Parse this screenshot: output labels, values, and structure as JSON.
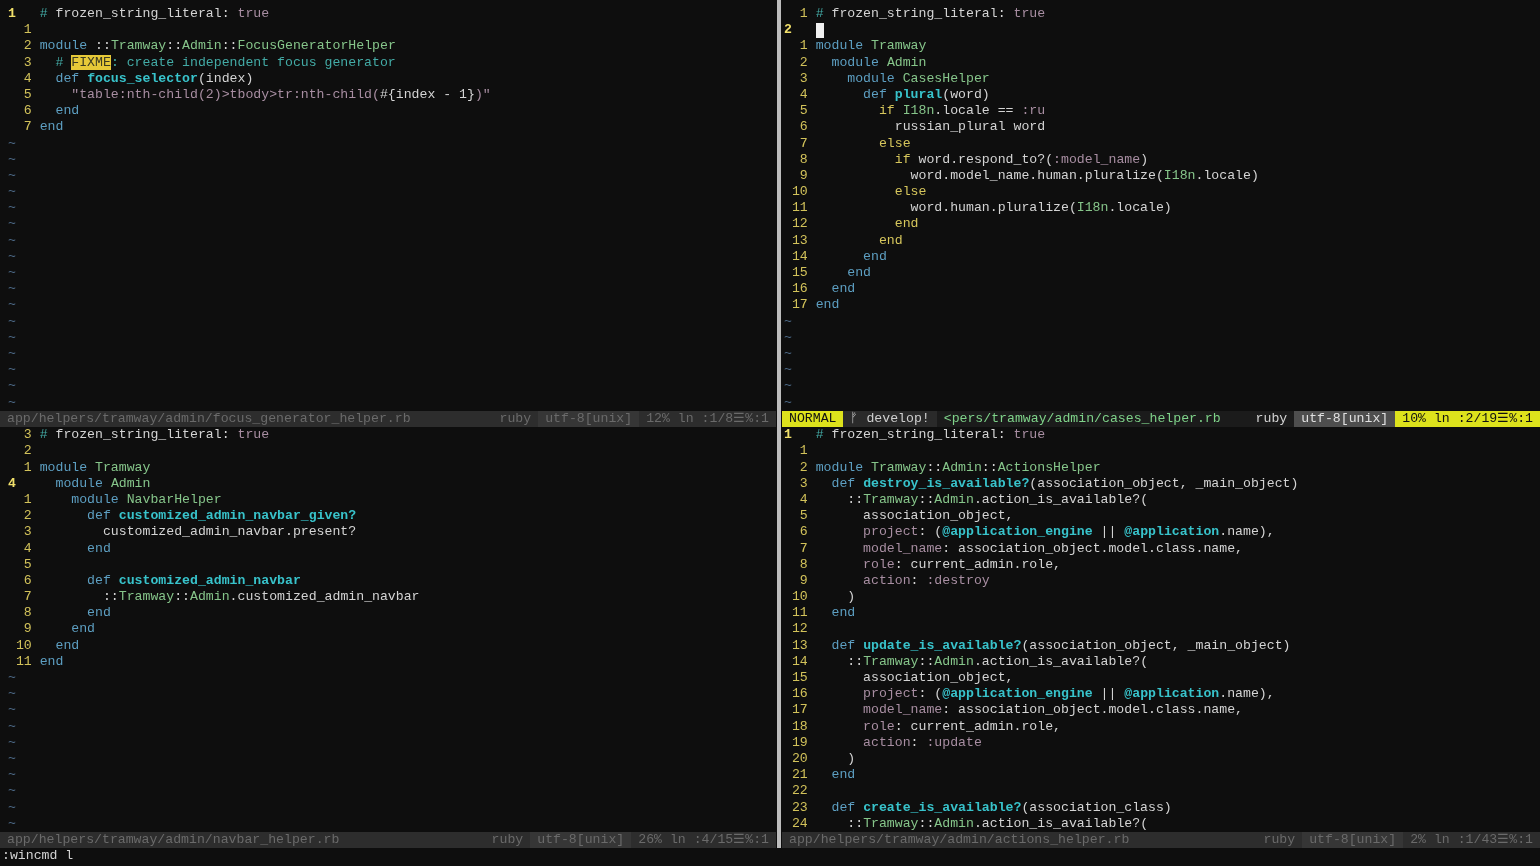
{
  "panes": [
    {
      "active": false,
      "lines": [
        {
          "num": "1",
          "current": true,
          "tokens": [
            {
              "kind": "comment",
              "text": "# "
            },
            {
              "kind": "note",
              "text": "frozen_string_literal: "
            },
            {
              "kind": "symbol",
              "text": "true"
            }
          ]
        },
        {
          "num": "1",
          "current": false
        },
        {
          "num": "2",
          "current": false,
          "tokens": [
            {
              "kind": "keyword",
              "text": "module "
            },
            {
              "kind": "plain",
              "text": "::"
            },
            {
              "kind": "constant",
              "text": "Tramway"
            },
            {
              "kind": "plain",
              "text": "::"
            },
            {
              "kind": "constant",
              "text": "Admin"
            },
            {
              "kind": "plain",
              "text": "::"
            },
            {
              "kind": "constant",
              "text": "FocusGeneratorHelper"
            }
          ]
        },
        {
          "num": "3",
          "current": false,
          "tokens": [
            {
              "kind": "comment",
              "text": "  # "
            },
            {
              "kind": "todo",
              "text": "FIXME"
            },
            {
              "kind": "comment",
              "text": ": create independent focus generator"
            }
          ]
        },
        {
          "num": "4",
          "current": false,
          "tokens": [
            {
              "kind": "keyword",
              "text": "  def "
            },
            {
              "kind": "method",
              "text": "focus_selector"
            },
            {
              "kind": "plain",
              "text": "(index)"
            }
          ]
        },
        {
          "num": "5",
          "current": false,
          "tokens": [
            {
              "kind": "string",
              "text": "    \"table:nth-child(2)>tbody>tr:nth-child("
            },
            {
              "kind": "plain",
              "text": "#{index - 1}"
            },
            {
              "kind": "string",
              "text": ")\""
            }
          ]
        },
        {
          "num": "6",
          "current": false,
          "tokens": [
            {
              "kind": "keyword",
              "text": "  end"
            }
          ]
        },
        {
          "num": "7",
          "current": false,
          "tokens": [
            {
              "kind": "keyword",
              "text": "end"
            }
          ]
        }
      ],
      "filler": [
        "~",
        "~",
        "~",
        "~",
        "~",
        "~",
        "~",
        "~",
        "~",
        "~",
        "~",
        "~",
        "~",
        "~",
        "~",
        "~",
        "~"
      ],
      "status": {
        "file": "app/helpers/tramway/admin/focus_generator_helper.rb",
        "filetype": "ruby",
        "encoding": "utf-8[unix]",
        "position": "12% ln :1/8☰%:1"
      }
    },
    {
      "active": true,
      "lines": [
        {
          "num": "1",
          "current": false,
          "tokens": [
            {
              "kind": "comment",
              "text": "# "
            },
            {
              "kind": "note",
              "text": "frozen_string_literal: "
            },
            {
              "kind": "symbol",
              "text": "true"
            }
          ]
        },
        {
          "num": "2",
          "current": true,
          "cursor": true
        },
        {
          "num": "1",
          "current": false,
          "tokens": [
            {
              "kind": "keyword",
              "text": "module "
            },
            {
              "kind": "constant",
              "text": "Tramway"
            }
          ]
        },
        {
          "num": "2",
          "current": false,
          "tokens": [
            {
              "kind": "keyword",
              "text": "  module "
            },
            {
              "kind": "constant",
              "text": "Admin"
            }
          ]
        },
        {
          "num": "3",
          "current": false,
          "tokens": [
            {
              "kind": "keyword",
              "text": "    module "
            },
            {
              "kind": "constant",
              "text": "CasesHelper"
            }
          ]
        },
        {
          "num": "4",
          "current": false,
          "tokens": [
            {
              "kind": "keyword",
              "text": "      def "
            },
            {
              "kind": "method",
              "text": "plural"
            },
            {
              "kind": "plain",
              "text": "(word)"
            }
          ]
        },
        {
          "num": "5",
          "current": false,
          "tokens": [
            {
              "kind": "conditional",
              "text": "        if "
            },
            {
              "kind": "constant",
              "text": "I18n"
            },
            {
              "kind": "plain",
              "text": ".locale == "
            },
            {
              "kind": "symbol",
              "text": ":ru"
            }
          ]
        },
        {
          "num": "6",
          "current": false,
          "tokens": [
            {
              "kind": "plain",
              "text": "          russian_plural word"
            }
          ]
        },
        {
          "num": "7",
          "current": false,
          "tokens": [
            {
              "kind": "conditional",
              "text": "        else"
            }
          ]
        },
        {
          "num": "8",
          "current": false,
          "tokens": [
            {
              "kind": "conditional",
              "text": "          if "
            },
            {
              "kind": "plain",
              "text": "word.respond_to?("
            },
            {
              "kind": "symbol",
              "text": ":model_name"
            },
            {
              "kind": "plain",
              "text": ")"
            }
          ]
        },
        {
          "num": "9",
          "current": false,
          "tokens": [
            {
              "kind": "plain",
              "text": "            word.model_name.human.pluralize("
            },
            {
              "kind": "constant",
              "text": "I18n"
            },
            {
              "kind": "plain",
              "text": ".locale)"
            }
          ]
        },
        {
          "num": "10",
          "current": false,
          "tokens": [
            {
              "kind": "conditional",
              "text": "          else"
            }
          ]
        },
        {
          "num": "11",
          "current": false,
          "tokens": [
            {
              "kind": "plain",
              "text": "            word.human.pluralize("
            },
            {
              "kind": "constant",
              "text": "I18n"
            },
            {
              "kind": "plain",
              "text": ".locale)"
            }
          ]
        },
        {
          "num": "12",
          "current": false,
          "tokens": [
            {
              "kind": "conditional",
              "text": "          end"
            }
          ]
        },
        {
          "num": "13",
          "current": false,
          "tokens": [
            {
              "kind": "conditional",
              "text": "        end"
            }
          ]
        },
        {
          "num": "14",
          "current": false,
          "tokens": [
            {
              "kind": "keyword",
              "text": "      end"
            }
          ]
        },
        {
          "num": "15",
          "current": false,
          "tokens": [
            {
              "kind": "keyword",
              "text": "    end"
            }
          ]
        },
        {
          "num": "16",
          "current": false,
          "tokens": [
            {
              "kind": "keyword",
              "text": "  end"
            }
          ]
        },
        {
          "num": "17",
          "current": false,
          "tokens": [
            {
              "kind": "keyword",
              "text": "end"
            }
          ]
        }
      ],
      "filler": [
        "~",
        "~",
        "~",
        "~",
        "~",
        "~"
      ],
      "status": {
        "mode": "NORMAL",
        "branch": "ᚠ develop!",
        "file": "<pers/tramway/admin/cases_helper.rb",
        "filetype": "ruby",
        "encoding": "utf-8[unix]",
        "position": "10% ln :2/19☰%:1"
      }
    },
    {
      "active": false,
      "lines": [
        {
          "num": "3",
          "current": false,
          "tokens": [
            {
              "kind": "comment",
              "text": "# "
            },
            {
              "kind": "note",
              "text": "frozen_string_literal: "
            },
            {
              "kind": "symbol",
              "text": "true"
            }
          ]
        },
        {
          "num": "2",
          "current": false
        },
        {
          "num": "1",
          "current": false,
          "tokens": [
            {
              "kind": "keyword",
              "text": "module "
            },
            {
              "kind": "constant",
              "text": "Tramway"
            }
          ]
        },
        {
          "num": "4",
          "current": true,
          "tokens": [
            {
              "kind": "keyword",
              "text": "  module "
            },
            {
              "kind": "constant",
              "text": "Admin"
            }
          ]
        },
        {
          "num": "1",
          "current": false,
          "tokens": [
            {
              "kind": "keyword",
              "text": "    module "
            },
            {
              "kind": "constant",
              "text": "NavbarHelper"
            }
          ]
        },
        {
          "num": "2",
          "current": false,
          "tokens": [
            {
              "kind": "keyword",
              "text": "      def "
            },
            {
              "kind": "method",
              "text": "customized_admin_navbar_given?"
            }
          ]
        },
        {
          "num": "3",
          "current": false,
          "tokens": [
            {
              "kind": "plain",
              "text": "        customized_admin_navbar.present?"
            }
          ]
        },
        {
          "num": "4",
          "current": false,
          "tokens": [
            {
              "kind": "keyword",
              "text": "      end"
            }
          ]
        },
        {
          "num": "5",
          "current": false
        },
        {
          "num": "6",
          "current": false,
          "tokens": [
            {
              "kind": "keyword",
              "text": "      def "
            },
            {
              "kind": "method",
              "text": "customized_admin_navbar"
            }
          ]
        },
        {
          "num": "7",
          "current": false,
          "tokens": [
            {
              "kind": "plain",
              "text": "        ::"
            },
            {
              "kind": "constant",
              "text": "Tramway"
            },
            {
              "kind": "plain",
              "text": "::"
            },
            {
              "kind": "constant",
              "text": "Admin"
            },
            {
              "kind": "plain",
              "text": ".customized_admin_navbar"
            }
          ]
        },
        {
          "num": "8",
          "current": false,
          "tokens": [
            {
              "kind": "keyword",
              "text": "      end"
            }
          ]
        },
        {
          "num": "9",
          "current": false,
          "tokens": [
            {
              "kind": "keyword",
              "text": "    end"
            }
          ]
        },
        {
          "num": "10",
          "current": false,
          "tokens": [
            {
              "kind": "keyword",
              "text": "  end"
            }
          ]
        },
        {
          "num": "11",
          "current": false,
          "tokens": [
            {
              "kind": "keyword",
              "text": "end"
            }
          ]
        }
      ],
      "filler": [
        "~",
        "~",
        "~",
        "~",
        "~",
        "~",
        "~",
        "~",
        "~",
        "~"
      ],
      "status": {
        "file": "app/helpers/tramway/admin/navbar_helper.rb",
        "filetype": "ruby",
        "encoding": "utf-8[unix]",
        "position": "26% ln :4/15☰%:1"
      }
    },
    {
      "active": false,
      "lines": [
        {
          "num": "1",
          "current": true,
          "tokens": [
            {
              "kind": "comment",
              "text": "# "
            },
            {
              "kind": "note",
              "text": "frozen_string_literal: "
            },
            {
              "kind": "symbol",
              "text": "true"
            }
          ]
        },
        {
          "num": "1",
          "current": false
        },
        {
          "num": "2",
          "current": false,
          "tokens": [
            {
              "kind": "keyword",
              "text": "module "
            },
            {
              "kind": "constant",
              "text": "Tramway"
            },
            {
              "kind": "plain",
              "text": "::"
            },
            {
              "kind": "constant",
              "text": "Admin"
            },
            {
              "kind": "plain",
              "text": "::"
            },
            {
              "kind": "constant",
              "text": "ActionsHelper"
            }
          ]
        },
        {
          "num": "3",
          "current": false,
          "tokens": [
            {
              "kind": "keyword",
              "text": "  def "
            },
            {
              "kind": "method",
              "text": "destroy_is_available?"
            },
            {
              "kind": "plain",
              "text": "(association_object, _main_object)"
            }
          ]
        },
        {
          "num": "4",
          "current": false,
          "tokens": [
            {
              "kind": "plain",
              "text": "    ::"
            },
            {
              "kind": "constant",
              "text": "Tramway"
            },
            {
              "kind": "plain",
              "text": "::"
            },
            {
              "kind": "constant",
              "text": "Admin"
            },
            {
              "kind": "plain",
              "text": ".action_is_available?("
            }
          ]
        },
        {
          "num": "5",
          "current": false,
          "tokens": [
            {
              "kind": "plain",
              "text": "      association_object,"
            }
          ]
        },
        {
          "num": "6",
          "current": false,
          "tokens": [
            {
              "kind": "symbol",
              "text": "      project"
            },
            {
              "kind": "plain",
              "text": ": ("
            },
            {
              "kind": "method",
              "text": "@application_engine"
            },
            {
              "kind": "plain",
              "text": " || "
            },
            {
              "kind": "method",
              "text": "@application"
            },
            {
              "kind": "plain",
              "text": ".name),"
            }
          ]
        },
        {
          "num": "7",
          "current": false,
          "tokens": [
            {
              "kind": "symbol",
              "text": "      model_name"
            },
            {
              "kind": "plain",
              "text": ": association_object.model.class.name,"
            }
          ]
        },
        {
          "num": "8",
          "current": false,
          "tokens": [
            {
              "kind": "symbol",
              "text": "      role"
            },
            {
              "kind": "plain",
              "text": ": current_admin.role,"
            }
          ]
        },
        {
          "num": "9",
          "current": false,
          "tokens": [
            {
              "kind": "symbol",
              "text": "      action"
            },
            {
              "kind": "plain",
              "text": ": "
            },
            {
              "kind": "symbol",
              "text": ":destroy"
            }
          ]
        },
        {
          "num": "10",
          "current": false,
          "tokens": [
            {
              "kind": "plain",
              "text": "    )"
            }
          ]
        },
        {
          "num": "11",
          "current": false,
          "tokens": [
            {
              "kind": "keyword",
              "text": "  end"
            }
          ]
        },
        {
          "num": "12",
          "current": false
        },
        {
          "num": "13",
          "current": false,
          "tokens": [
            {
              "kind": "keyword",
              "text": "  def "
            },
            {
              "kind": "method",
              "text": "update_is_available?"
            },
            {
              "kind": "plain",
              "text": "(association_object, _main_object)"
            }
          ]
        },
        {
          "num": "14",
          "current": false,
          "tokens": [
            {
              "kind": "plain",
              "text": "    ::"
            },
            {
              "kind": "constant",
              "text": "Tramway"
            },
            {
              "kind": "plain",
              "text": "::"
            },
            {
              "kind": "constant",
              "text": "Admin"
            },
            {
              "kind": "plain",
              "text": ".action_is_available?("
            }
          ]
        },
        {
          "num": "15",
          "current": false,
          "tokens": [
            {
              "kind": "plain",
              "text": "      association_object,"
            }
          ]
        },
        {
          "num": "16",
          "current": false,
          "tokens": [
            {
              "kind": "symbol",
              "text": "      project"
            },
            {
              "kind": "plain",
              "text": ": ("
            },
            {
              "kind": "method",
              "text": "@application_engine"
            },
            {
              "kind": "plain",
              "text": " || "
            },
            {
              "kind": "method",
              "text": "@application"
            },
            {
              "kind": "plain",
              "text": ".name),"
            }
          ]
        },
        {
          "num": "17",
          "current": false,
          "tokens": [
            {
              "kind": "symbol",
              "text": "      model_name"
            },
            {
              "kind": "plain",
              "text": ": association_object.model.class.name,"
            }
          ]
        },
        {
          "num": "18",
          "current": false,
          "tokens": [
            {
              "kind": "symbol",
              "text": "      role"
            },
            {
              "kind": "plain",
              "text": ": current_admin.role,"
            }
          ]
        },
        {
          "num": "19",
          "current": false,
          "tokens": [
            {
              "kind": "symbol",
              "text": "      action"
            },
            {
              "kind": "plain",
              "text": ": "
            },
            {
              "kind": "symbol",
              "text": ":update"
            }
          ]
        },
        {
          "num": "20",
          "current": false,
          "tokens": [
            {
              "kind": "plain",
              "text": "    )"
            }
          ]
        },
        {
          "num": "21",
          "current": false,
          "tokens": [
            {
              "kind": "keyword",
              "text": "  end"
            }
          ]
        },
        {
          "num": "22",
          "current": false
        },
        {
          "num": "23",
          "current": false,
          "tokens": [
            {
              "kind": "keyword",
              "text": "  def "
            },
            {
              "kind": "method",
              "text": "create_is_available?"
            },
            {
              "kind": "plain",
              "text": "(association_class)"
            }
          ]
        },
        {
          "num": "24",
          "current": false,
          "tokens": [
            {
              "kind": "plain",
              "text": "    ::"
            },
            {
              "kind": "constant",
              "text": "Tramway"
            },
            {
              "kind": "plain",
              "text": "::"
            },
            {
              "kind": "constant",
              "text": "Admin"
            },
            {
              "kind": "plain",
              "text": ".action_is_available?("
            }
          ]
        }
      ],
      "status": {
        "file": "app/helpers/tramway/admin/actions_helper.rb",
        "filetype": "ruby",
        "encoding": "utf-8[unix]",
        "position": "2% ln :1/43☰%:1"
      }
    }
  ],
  "command_line": ":wincmd l"
}
